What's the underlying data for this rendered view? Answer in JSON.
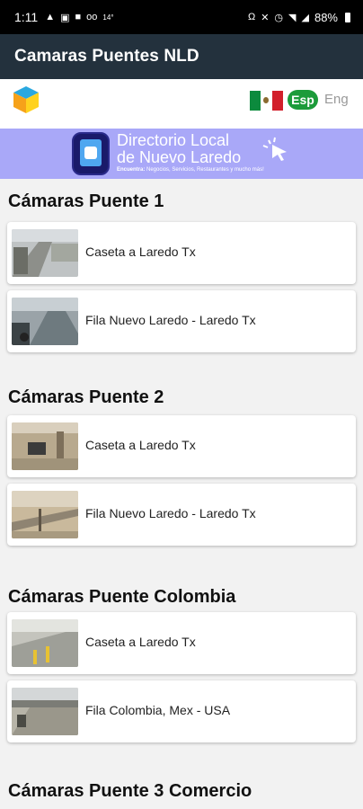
{
  "status_bar": {
    "time": "1:11",
    "left_icons": [
      "warning-icon",
      "image-icon",
      "video-icon",
      "voicemail-icon"
    ],
    "temp": "14°",
    "right_icons": [
      "headphones-icon",
      "mute-icon",
      "alarm-icon",
      "wifi-icon",
      "signal-icon"
    ],
    "battery": "88%"
  },
  "app_bar": {
    "title": "Camaras Puentes NLD"
  },
  "language": {
    "spanish": "Esp",
    "english": "Eng",
    "flag": "mexico-flag"
  },
  "banner": {
    "line1": "Directorio Local",
    "line2": "de Nuevo Laredo",
    "subtitle_bold": "Encuentra:",
    "subtitle": " Negocios, Servicios, Restaurantes y mucho más!"
  },
  "sections": [
    {
      "title": "Cámaras Puente 1",
      "cameras": [
        {
          "label": "Caseta a Laredo Tx"
        },
        {
          "label": "Fila Nuevo Laredo - Laredo Tx"
        }
      ]
    },
    {
      "title": "Cámaras Puente 2",
      "cameras": [
        {
          "label": "Caseta a Laredo Tx"
        },
        {
          "label": "Fila Nuevo Laredo - Laredo Tx"
        }
      ]
    },
    {
      "title": "Cámaras Puente Colombia",
      "cameras": [
        {
          "label": "Caseta a Laredo Tx"
        },
        {
          "label": "Fila Colombia, Mex - USA"
        }
      ]
    },
    {
      "title": "Cámaras Puente 3 Comercio",
      "cameras": []
    }
  ],
  "colors": {
    "app_bar": "#23313d",
    "banner": "#a9a8f8",
    "esp_badge": "#1c9b3a"
  }
}
